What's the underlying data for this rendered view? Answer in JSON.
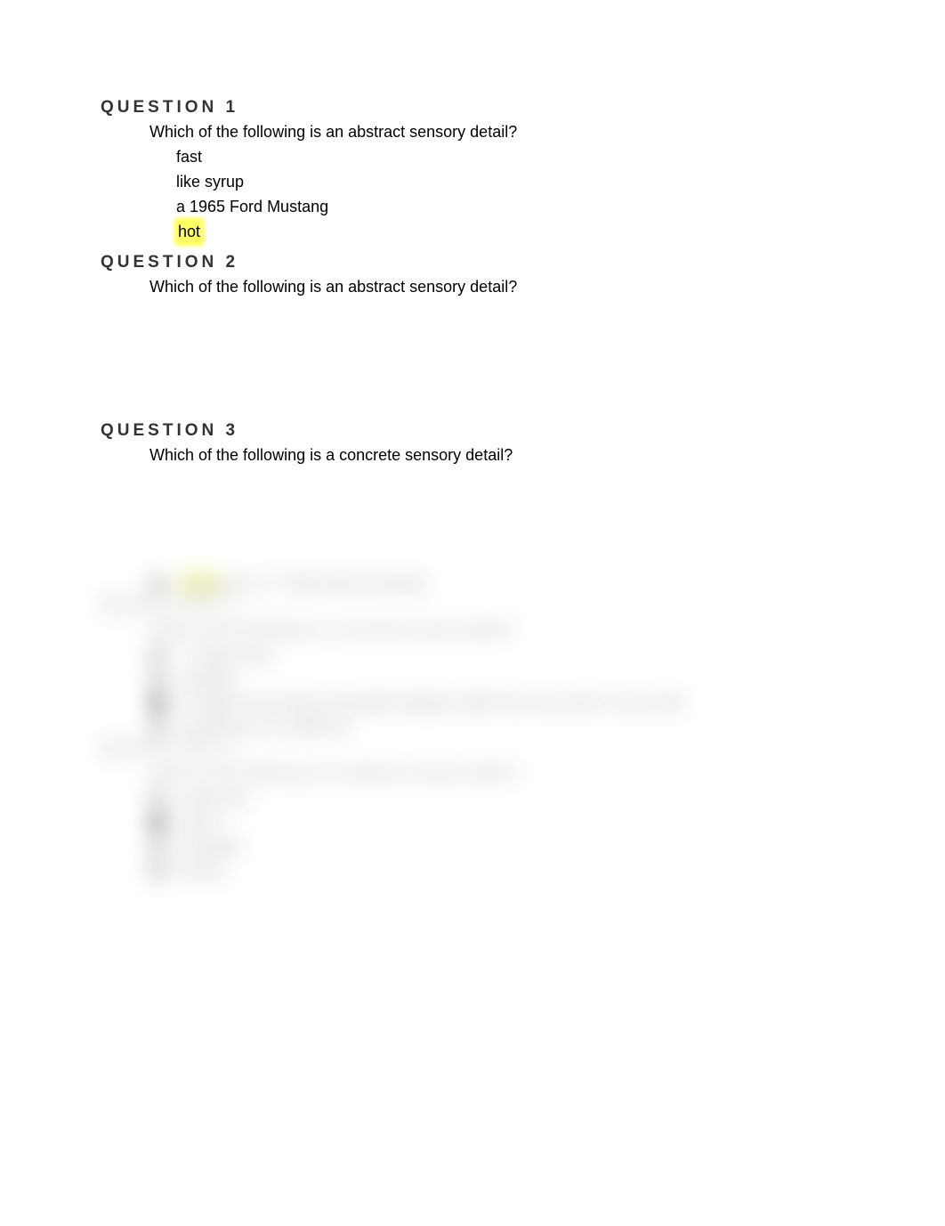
{
  "questions": [
    {
      "title": "QUESTION 1",
      "prompt": "Which of the following is an abstract sensory detail?",
      "options": [
        {
          "label": "fast",
          "highlighted": false
        },
        {
          "label": "like syrup",
          "highlighted": false
        },
        {
          "label": "a 1965 Ford Mustang",
          "highlighted": false
        },
        {
          "label": "hot",
          "highlighted": true
        }
      ]
    },
    {
      "title": "QUESTION 2",
      "prompt": "Which of the following is an abstract sensory detail?"
    },
    {
      "title": "QUESTION 3",
      "prompt": "Which of the following is a concrete sensory detail?"
    }
  ]
}
